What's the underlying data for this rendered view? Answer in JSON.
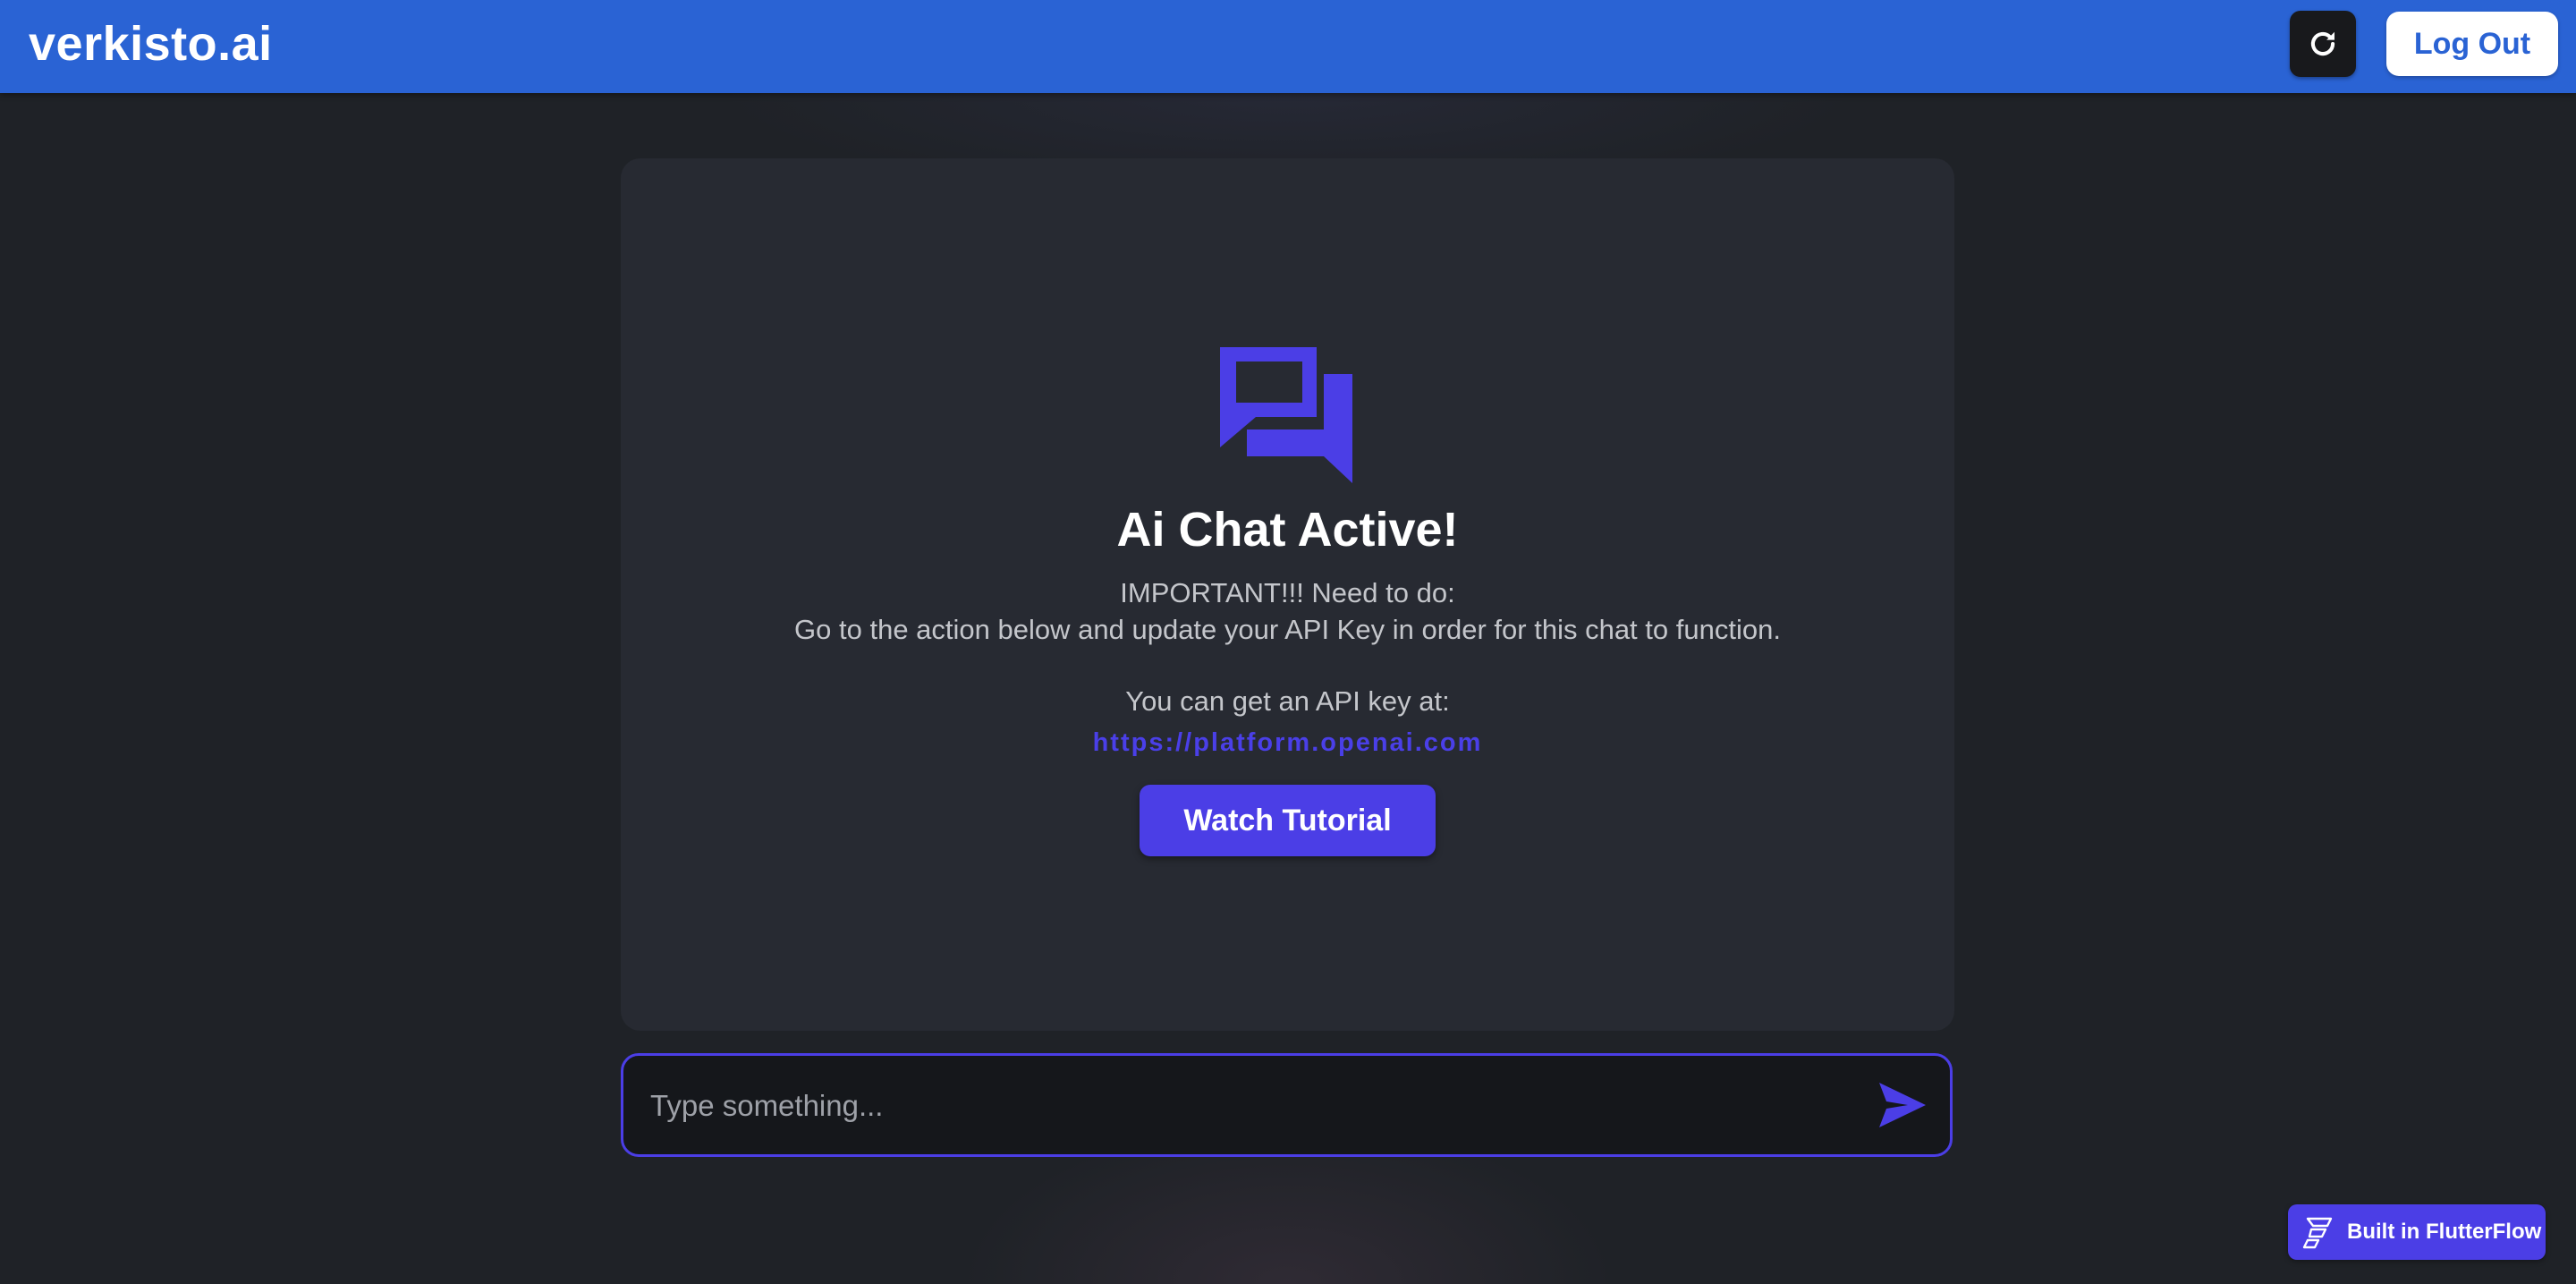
{
  "header": {
    "brand": "verkisto.ai",
    "refresh_icon": "refresh-icon",
    "logout_label": "Log Out"
  },
  "main": {
    "icon": "chat-bubbles-icon",
    "title": "Ai Chat Active!",
    "message_line_1": "IMPORTANT!!! Need to do:",
    "message_line_2": "Go to the action below and update your API Key in order for this chat to function.",
    "message_line_3": "You can get an API key at:",
    "link_text": "https://platform.openai.com",
    "tutorial_button_label": "Watch Tutorial"
  },
  "composer": {
    "placeholder": "Type something...",
    "value": "",
    "send_icon": "send-icon"
  },
  "badge": {
    "icon": "flutterflow-icon",
    "label": "Built in FlutterFlow"
  },
  "colors": {
    "header_bg": "#2a63d4",
    "accent": "#4b3ee6",
    "page_bg": "#1f2227",
    "card_bg": "#272a32"
  }
}
